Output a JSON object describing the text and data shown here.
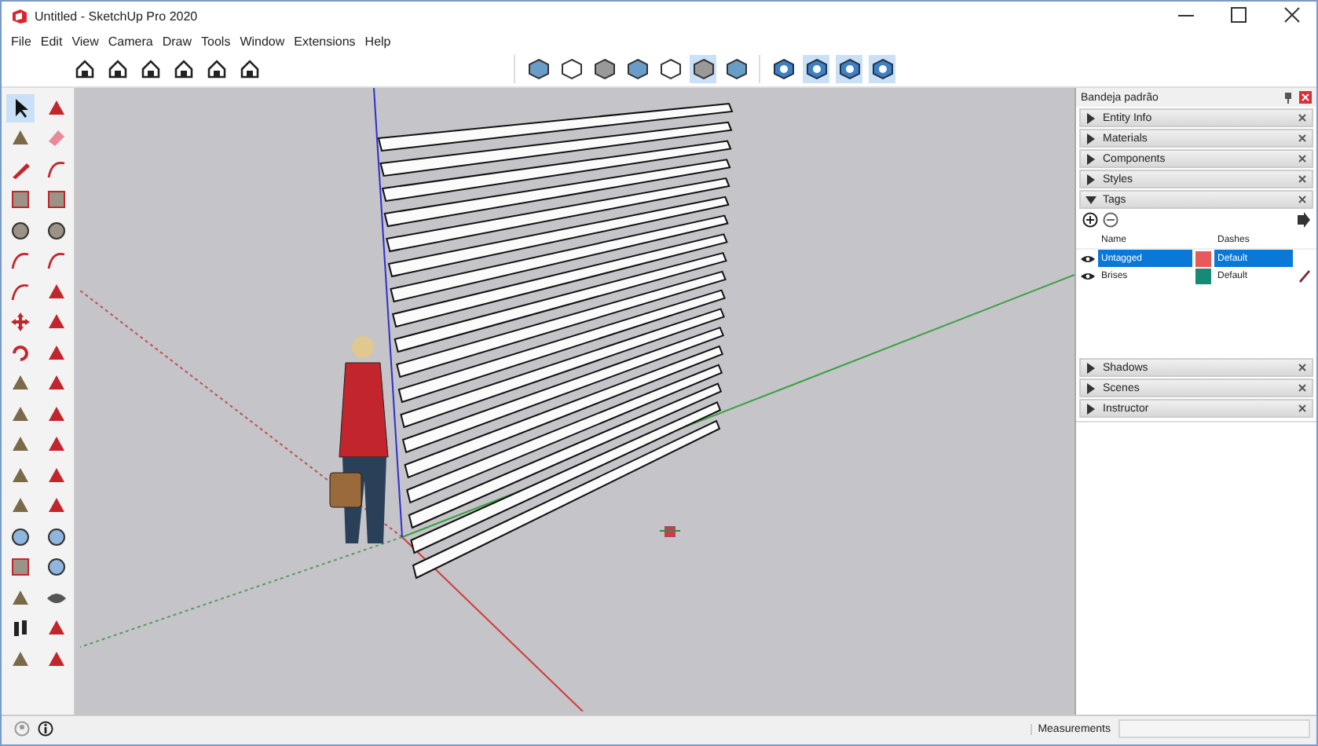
{
  "window": {
    "title": "Untitled - SketchUp Pro 2020"
  },
  "menu": [
    "File",
    "Edit",
    "View",
    "Camera",
    "Draw",
    "Tools",
    "Window",
    "Extensions",
    "Help"
  ],
  "toolbar": {
    "views": [
      {
        "on": false
      },
      {
        "on": false
      },
      {
        "on": false
      },
      {
        "on": false
      },
      {
        "on": false
      },
      {
        "on": false
      }
    ],
    "styles": [
      {
        "on": false
      },
      {
        "on": false
      },
      {
        "on": false
      },
      {
        "on": false
      },
      {
        "on": false
      },
      {
        "on": true
      },
      {
        "on": false
      }
    ],
    "navigation": [
      {
        "on": false
      },
      {
        "on": true
      },
      {
        "on": true
      },
      {
        "on": true
      }
    ]
  },
  "left_toolbar": {
    "select_active": true
  },
  "tray": {
    "title": "Bandeja padrão",
    "panels_top": [
      {
        "label": "Entity Info",
        "expanded": false
      },
      {
        "label": "Materials",
        "expanded": false
      },
      {
        "label": "Components",
        "expanded": false
      },
      {
        "label": "Styles",
        "expanded": false
      },
      {
        "label": "Tags",
        "expanded": true
      }
    ],
    "tags": {
      "columns": [
        "Name",
        "Dashes"
      ],
      "rows": [
        {
          "name": "Untagged",
          "color": "#e8595c",
          "dashes": "Default",
          "selected": true,
          "current": false
        },
        {
          "name": "Brises",
          "color": "#158a76",
          "dashes": "Default",
          "selected": false,
          "current": true
        }
      ]
    },
    "panels_bottom": [
      {
        "label": "Shadows",
        "expanded": false
      },
      {
        "label": "Scenes",
        "expanded": false
      },
      {
        "label": "Instructor",
        "expanded": false
      }
    ]
  },
  "status_bar": {
    "measurements_label": "Measurements"
  }
}
